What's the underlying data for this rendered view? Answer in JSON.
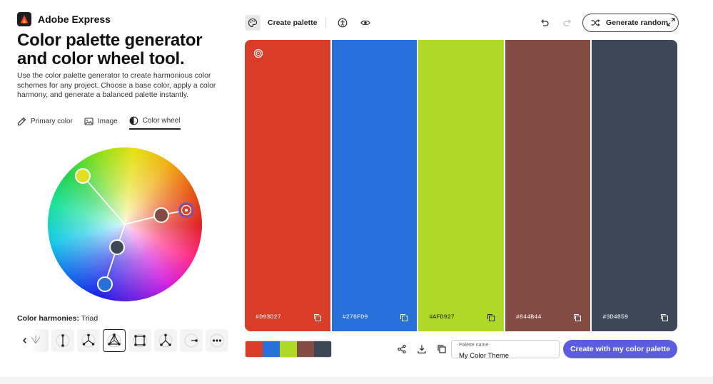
{
  "brand": {
    "name": "Adobe Express",
    "logo_color": "#FF0000"
  },
  "hero": {
    "title": "Color palette generator and color wheel tool.",
    "description": "Use the color palette generator to create harmonious color schemes for any project. Choose a base color, apply a color harmony, and generate a balanced palette instantly."
  },
  "modes": [
    {
      "label": "Primary color",
      "icon": "eyedropper-icon",
      "active": false
    },
    {
      "label": "Image",
      "icon": "image-icon",
      "active": false
    },
    {
      "label": "Color wheel",
      "icon": "color-wheel-icon",
      "active": true
    }
  ],
  "harmonies": {
    "label": "Color harmonies:",
    "selected": "Triad",
    "options": [
      "analogous",
      "monochromatic",
      "triad-split",
      "triad",
      "square",
      "compound",
      "shades",
      "custom"
    ]
  },
  "topbar": {
    "create_palette_label": "Create palette"
  },
  "actions": {
    "generate_random_label": "Generate random",
    "cta_label": "Create with my color palette"
  },
  "palette": [
    {
      "hex": "#D93D27",
      "color": "#D93D27"
    },
    {
      "hex": "#276FD9",
      "color": "#276FD9"
    },
    {
      "hex": "#AFD927",
      "color": "#AFD927"
    },
    {
      "hex": "#844B44",
      "color": "#844B44"
    },
    {
      "hex": "#3D4859",
      "color": "#3D4859"
    }
  ],
  "palette_name": {
    "label": "Palette name",
    "value": "My Color Theme"
  },
  "accent_color": "#5C5CE0"
}
